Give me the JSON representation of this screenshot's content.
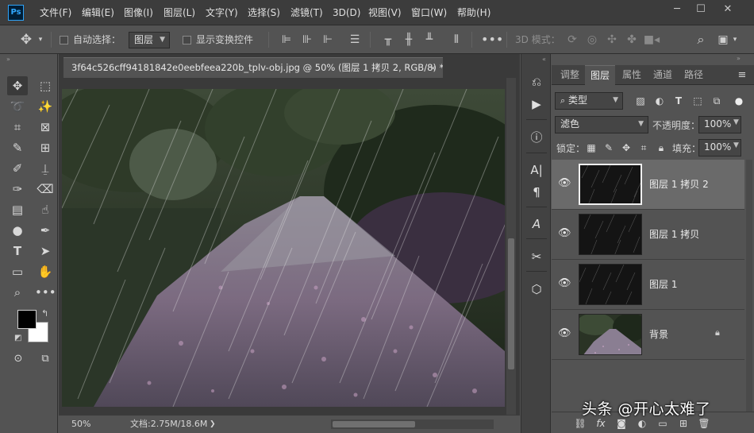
{
  "app": {
    "logo": "Ps"
  },
  "menu": [
    "文件(F)",
    "编辑(E)",
    "图像(I)",
    "图层(L)",
    "文字(Y)",
    "选择(S)",
    "滤镜(T)",
    "3D(D)",
    "视图(V)",
    "窗口(W)",
    "帮助(H)"
  ],
  "window_controls": {
    "minimize": "─",
    "restore": "☐",
    "close": "✕"
  },
  "options": {
    "auto_select_label": "自动选择：",
    "auto_select_target": "图层",
    "show_transform_label": "显示变换控件",
    "mode_3d_label": "3D 模式："
  },
  "document": {
    "tab_title": "3f64c526cff94181842e0eebfeea220b_tplv-obj.jpg @ 50% (图层 1 拷贝 2, RGB/8) *",
    "close_glyph": "×",
    "zoom": "50%",
    "doc_info": "文档:2.75M/18.6M"
  },
  "panels": {
    "tabs": [
      "调整",
      "图层",
      "属性",
      "通道",
      "路径"
    ],
    "active_tab": "图层",
    "filter_kind": "类型",
    "blend_mode": "滤色",
    "opacity_label": "不透明度：",
    "opacity_value": "100%",
    "lock_label": "锁定：",
    "fill_label": "填充：",
    "fill_value": "100%"
  },
  "layers": [
    {
      "name": "图层 1 拷贝 2",
      "selected": true,
      "type": "rain"
    },
    {
      "name": "图层 1 拷贝",
      "selected": false,
      "type": "rain"
    },
    {
      "name": "图层 1",
      "selected": false,
      "type": "rain"
    },
    {
      "name": "背景",
      "selected": false,
      "type": "photo",
      "locked": true
    }
  ],
  "watermark": "头条 @开心太难了",
  "colors": {
    "foreground": "#000000",
    "background": "#ffffff",
    "ps_blue": "#31a8ff"
  }
}
